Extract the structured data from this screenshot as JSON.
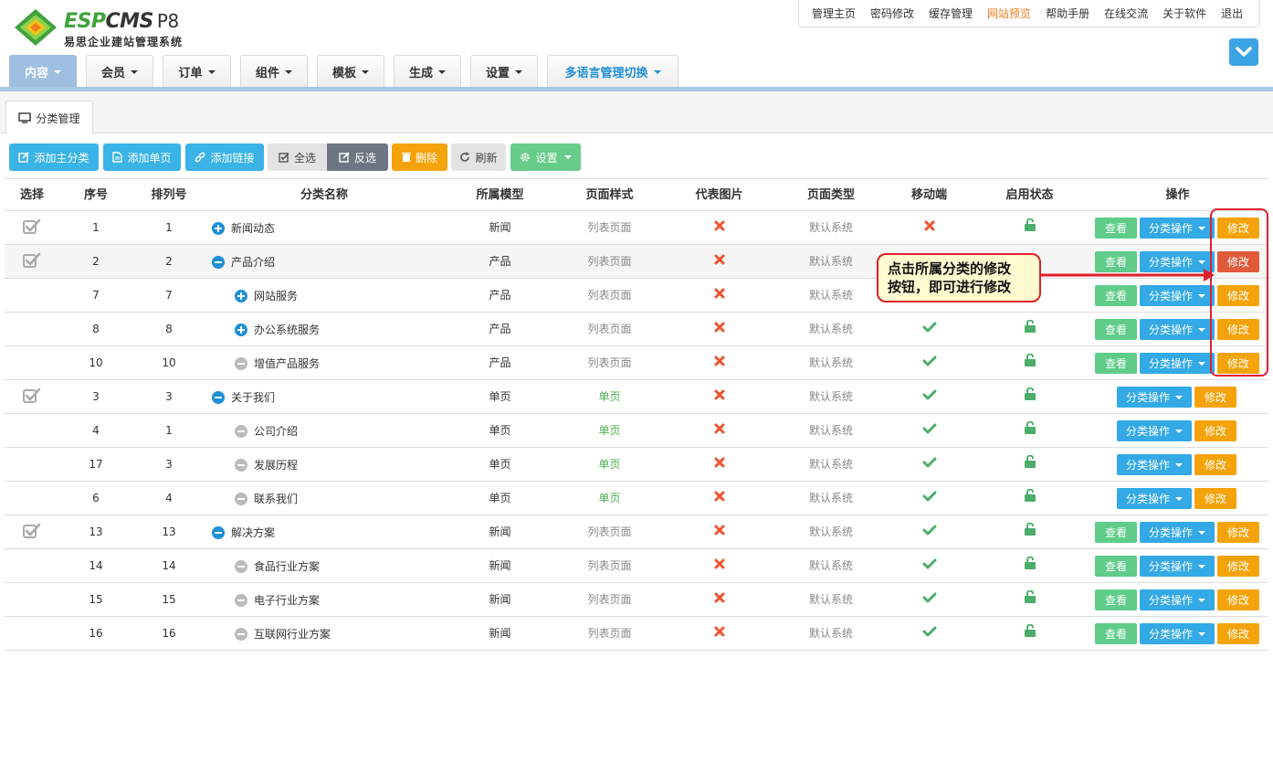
{
  "header": {
    "brand_left": "ESP",
    "brand_right": "CMS",
    "brand_version": "P8",
    "subtitle": "易思企业建站管理系统",
    "top_links": [
      "管理主页",
      "密码修改",
      "缓存管理",
      "网站预览",
      "帮助手册",
      "在线交流",
      "关于软件",
      "退出"
    ],
    "highlight_link": "网站预览"
  },
  "nav": {
    "tabs": [
      "内容",
      "会员",
      "订单",
      "组件",
      "模板",
      "生成",
      "设置",
      "多语言管理切换"
    ],
    "active": "内容"
  },
  "subtab": {
    "label": "分类管理"
  },
  "toolbar": {
    "add_main": "添加主分类",
    "add_page": "添加单页",
    "add_link": "添加链接",
    "select_all": "全选",
    "invert": "反选",
    "delete": "删除",
    "refresh": "刷新",
    "settings": "设置"
  },
  "table": {
    "headers": [
      "选择",
      "序号",
      "排列号",
      "分类名称",
      "所属模型",
      "页面样式",
      "代表图片",
      "页面类型",
      "移动端",
      "启用状态",
      "操作"
    ],
    "buttons": {
      "view": "查看",
      "op": "分类操作",
      "edit": "修改"
    },
    "rows": [
      {
        "check": true,
        "id": "1",
        "order": "1",
        "name": "新闻动态",
        "level": 0,
        "icon": "plus",
        "model": "新闻",
        "style": "列表页面",
        "type": "默认系统",
        "mobile": "no",
        "enabled": true,
        "view": true
      },
      {
        "check": true,
        "id": "2",
        "order": "2",
        "name": "产品介绍",
        "level": 0,
        "icon": "minus",
        "model": "产品",
        "style": "列表页面",
        "type": "默认系统",
        "mobile": "",
        "enabled": false,
        "view": true
      },
      {
        "check": false,
        "id": "7",
        "order": "7",
        "name": "网站服务",
        "level": 1,
        "icon": "plus",
        "model": "产品",
        "style": "列表页面",
        "type": "默认系统",
        "mobile": "",
        "enabled": false,
        "view": true
      },
      {
        "check": false,
        "id": "8",
        "order": "8",
        "name": "办公系统服务",
        "level": 1,
        "icon": "plus",
        "model": "产品",
        "style": "列表页面",
        "type": "默认系统",
        "mobile": "yes",
        "enabled": true,
        "view": true
      },
      {
        "check": false,
        "id": "10",
        "order": "10",
        "name": "增值产品服务",
        "level": 1,
        "icon": "leaf",
        "model": "产品",
        "style": "列表页面",
        "type": "默认系统",
        "mobile": "yes",
        "enabled": true,
        "view": true
      },
      {
        "check": true,
        "id": "3",
        "order": "3",
        "name": "关于我们",
        "level": 0,
        "icon": "minus",
        "model": "单页",
        "style": "单页",
        "type": "默认系统",
        "mobile": "yes",
        "enabled": true,
        "view": false
      },
      {
        "check": false,
        "id": "4",
        "order": "1",
        "name": "公司介绍",
        "level": 1,
        "icon": "leaf",
        "model": "单页",
        "style": "单页",
        "type": "默认系统",
        "mobile": "yes",
        "enabled": true,
        "view": false
      },
      {
        "check": false,
        "id": "17",
        "order": "3",
        "name": "发展历程",
        "level": 1,
        "icon": "leaf",
        "model": "单页",
        "style": "单页",
        "type": "默认系统",
        "mobile": "yes",
        "enabled": true,
        "view": false
      },
      {
        "check": false,
        "id": "6",
        "order": "4",
        "name": "联系我们",
        "level": 1,
        "icon": "leaf",
        "model": "单页",
        "style": "单页",
        "type": "默认系统",
        "mobile": "yes",
        "enabled": true,
        "view": false
      },
      {
        "check": true,
        "id": "13",
        "order": "13",
        "name": "解决方案",
        "level": 0,
        "icon": "minus",
        "model": "新闻",
        "style": "列表页面",
        "type": "默认系统",
        "mobile": "yes",
        "enabled": true,
        "view": true
      },
      {
        "check": false,
        "id": "14",
        "order": "14",
        "name": "食品行业方案",
        "level": 1,
        "icon": "leaf",
        "model": "新闻",
        "style": "列表页面",
        "type": "默认系统",
        "mobile": "yes",
        "enabled": true,
        "view": true
      },
      {
        "check": false,
        "id": "15",
        "order": "15",
        "name": "电子行业方案",
        "level": 1,
        "icon": "leaf",
        "model": "新闻",
        "style": "列表页面",
        "type": "默认系统",
        "mobile": "yes",
        "enabled": true,
        "view": true
      },
      {
        "check": false,
        "id": "16",
        "order": "16",
        "name": "互联网行业方案",
        "level": 1,
        "icon": "leaf",
        "model": "新闻",
        "style": "列表页面",
        "type": "默认系统",
        "mobile": "yes",
        "enabled": true,
        "view": true
      }
    ],
    "highlight_edit_row": 1
  },
  "annotation": {
    "line1": "点击所属分类的修改",
    "line2": "按钮，即可进行修改"
  },
  "colors": {
    "accent_blue": "#33a9e6",
    "green": "#5fcc8a",
    "orange": "#f5a30b",
    "red": "#e0202a",
    "nav_active": "#9ebfdf"
  }
}
